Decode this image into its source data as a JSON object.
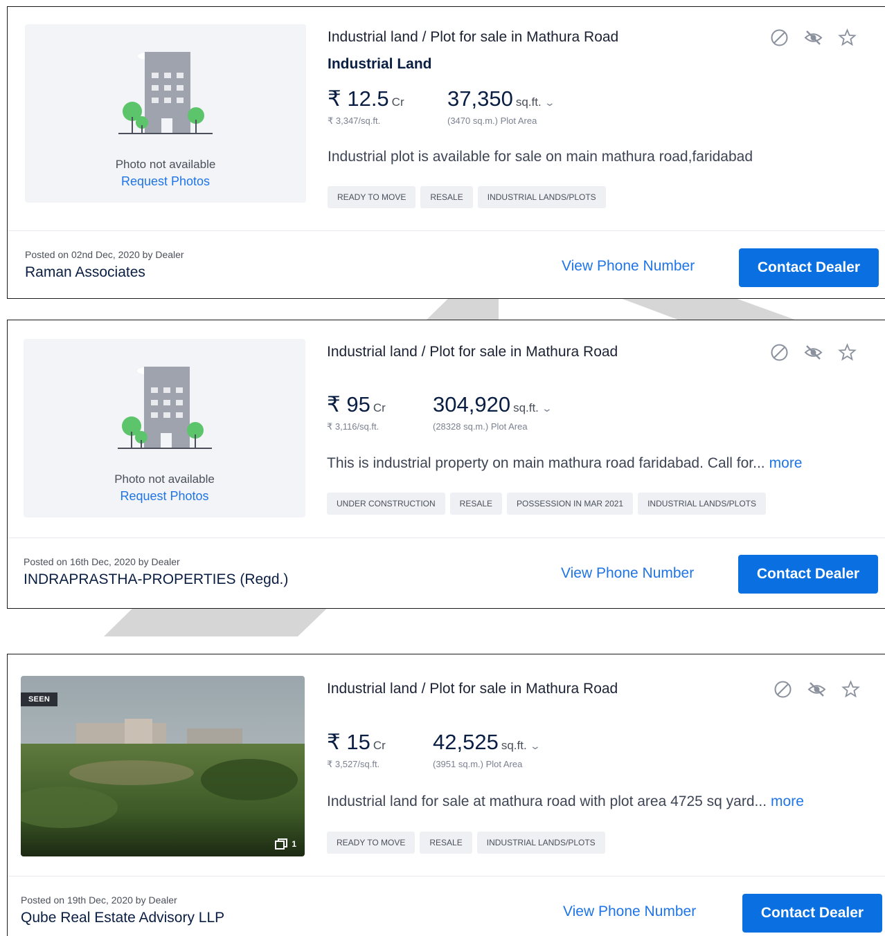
{
  "listings": [
    {
      "photo_available": false,
      "photo_text": "Photo not available",
      "photo_link": "Request Photos",
      "title": "Industrial land / Plot for sale in Mathura Road",
      "subtitle": "Industrial Land",
      "price": "₹ 12.5",
      "price_unit": "Cr",
      "price_per_sqft": "₹ 3,347/sq.ft.",
      "area": "37,350",
      "area_unit": "sq.ft.",
      "area_detail": "(3470 sq.m.) Plot Area",
      "description": "Industrial plot is available for sale on main mathura road,faridabad",
      "more_label": "",
      "tags": [
        "READY TO MOVE",
        "RESALE",
        "INDUSTRIAL LANDS/PLOTS"
      ],
      "posted": "Posted on 02nd Dec, 2020 by Dealer",
      "dealer": "Raman Associates",
      "view_phone": "View Phone Number",
      "contact": "Contact Dealer"
    },
    {
      "photo_available": false,
      "photo_text": "Photo not available",
      "photo_link": "Request Photos",
      "title": "Industrial land / Plot for sale in Mathura Road",
      "subtitle": "",
      "price": "₹ 95",
      "price_unit": "Cr",
      "price_per_sqft": "₹ 3,116/sq.ft.",
      "area": "304,920",
      "area_unit": "sq.ft.",
      "area_detail": "(28328 sq.m.) Plot Area",
      "description": "This is industrial property on main mathura road faridabad. Call for...",
      "more_label": "more",
      "tags": [
        "UNDER CONSTRUCTION",
        "RESALE",
        "POSSESSION IN MAR 2021",
        "INDUSTRIAL LANDS/PLOTS"
      ],
      "posted": "Posted on 16th Dec, 2020 by Dealer",
      "dealer": "INDRAPRASTHA-PROPERTIES (Regd.)",
      "view_phone": "View Phone Number",
      "contact": "Contact Dealer"
    },
    {
      "photo_available": true,
      "seen_badge": "SEEN",
      "photo_count": "1",
      "title": "Industrial land / Plot for sale in Mathura Road",
      "subtitle": "",
      "price": "₹ 15",
      "price_unit": "Cr",
      "price_per_sqft": "₹ 3,527/sq.ft.",
      "area": "42,525",
      "area_unit": "sq.ft.",
      "area_detail": "(3951 sq.m.) Plot Area",
      "description": "Industrial land for sale at mathura road with plot area 4725 sq yard...",
      "more_label": "more",
      "tags": [
        "READY TO MOVE",
        "RESALE",
        "INDUSTRIAL LANDS/PLOTS"
      ],
      "posted": "Posted on 19th Dec, 2020 by Dealer",
      "dealer": "Qube Real Estate Advisory LLP",
      "view_phone": "View Phone Number",
      "contact": "Contact Dealer"
    }
  ],
  "icons": [
    "block-icon",
    "hide-icon",
    "shortlist-star-icon"
  ],
  "colors": {
    "link": "#1f74e6",
    "button": "#0a6fe0",
    "tag_bg": "#eef0f4",
    "heading": "#091e42"
  }
}
